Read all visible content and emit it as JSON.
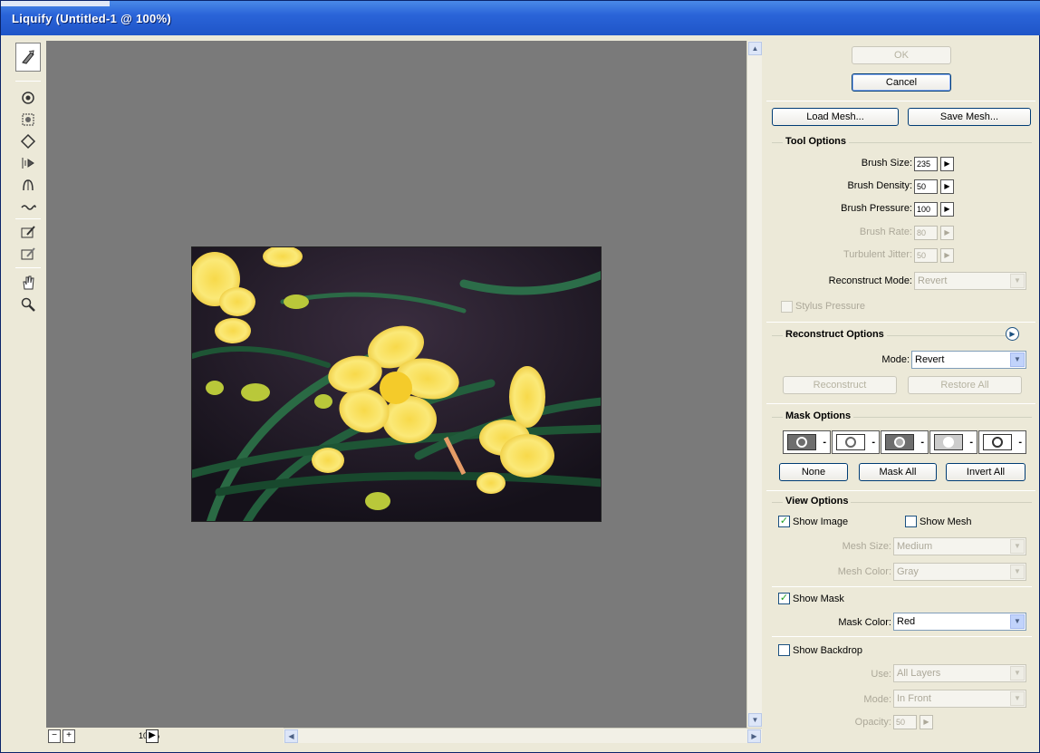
{
  "window": {
    "title": "Liquify (Untitled-1 @ 100%)"
  },
  "toolbar": {
    "tools": [
      {
        "name": "forward-warp-tool-icon"
      },
      {
        "name": "twirl-tool-icon"
      },
      {
        "name": "pucker-tool-icon"
      },
      {
        "name": "bloat-tool-icon"
      },
      {
        "name": "push-left-tool-icon"
      },
      {
        "name": "mirror-tool-icon"
      },
      {
        "name": "turbulence-tool-icon"
      },
      {
        "name": "freeze-mask-tool-icon"
      },
      {
        "name": "thaw-mask-tool-icon"
      },
      {
        "name": "hand-tool-icon"
      },
      {
        "name": "zoom-tool-icon"
      }
    ]
  },
  "zoom": {
    "minus": "−",
    "plus": "+",
    "value": "100%",
    "menu": "▶"
  },
  "panel": {
    "ok_label": "OK",
    "cancel_label": "Cancel",
    "load_mesh_label": "Load Mesh...",
    "save_mesh_label": "Save Mesh...",
    "tool_options": {
      "title": "Tool Options",
      "brush_size_label": "Brush Size:",
      "brush_size_value": "235",
      "brush_density_label": "Brush Density:",
      "brush_density_value": "50",
      "brush_pressure_label": "Brush Pressure:",
      "brush_pressure_value": "100",
      "brush_rate_label": "Brush Rate:",
      "brush_rate_value": "80",
      "turbulent_jitter_label": "Turbulent Jitter:",
      "turbulent_jitter_value": "50",
      "reconstruct_mode_label": "Reconstruct Mode:",
      "reconstruct_mode_value": "Revert",
      "stylus_pressure_label": "Stylus Pressure"
    },
    "reconstruct_options": {
      "title": "Reconstruct Options",
      "mode_label": "Mode:",
      "mode_value": "Revert",
      "reconstruct_label": "Reconstruct",
      "restore_all_label": "Restore All"
    },
    "mask_options": {
      "title": "Mask Options",
      "none_label": "None",
      "mask_all_label": "Mask All",
      "invert_all_label": "Invert All"
    },
    "view_options": {
      "title": "View Options",
      "show_image_label": "Show Image",
      "show_mesh_label": "Show Mesh",
      "mesh_size_label": "Mesh Size:",
      "mesh_size_value": "Medium",
      "mesh_color_label": "Mesh Color:",
      "mesh_color_value": "Gray",
      "show_mask_label": "Show Mask",
      "mask_color_label": "Mask Color:",
      "mask_color_value": "Red",
      "show_backdrop_label": "Show Backdrop",
      "use_label": "Use:",
      "use_value": "All Layers",
      "mode_label": "Mode:",
      "mode_value": "In Front",
      "opacity_label": "Opacity:",
      "opacity_value": "50"
    }
  },
  "checkmark": "✓",
  "colors": {
    "title_bar": "#1f55c8",
    "canvas": "#7a7a7a",
    "panel": "#ece9d8"
  }
}
